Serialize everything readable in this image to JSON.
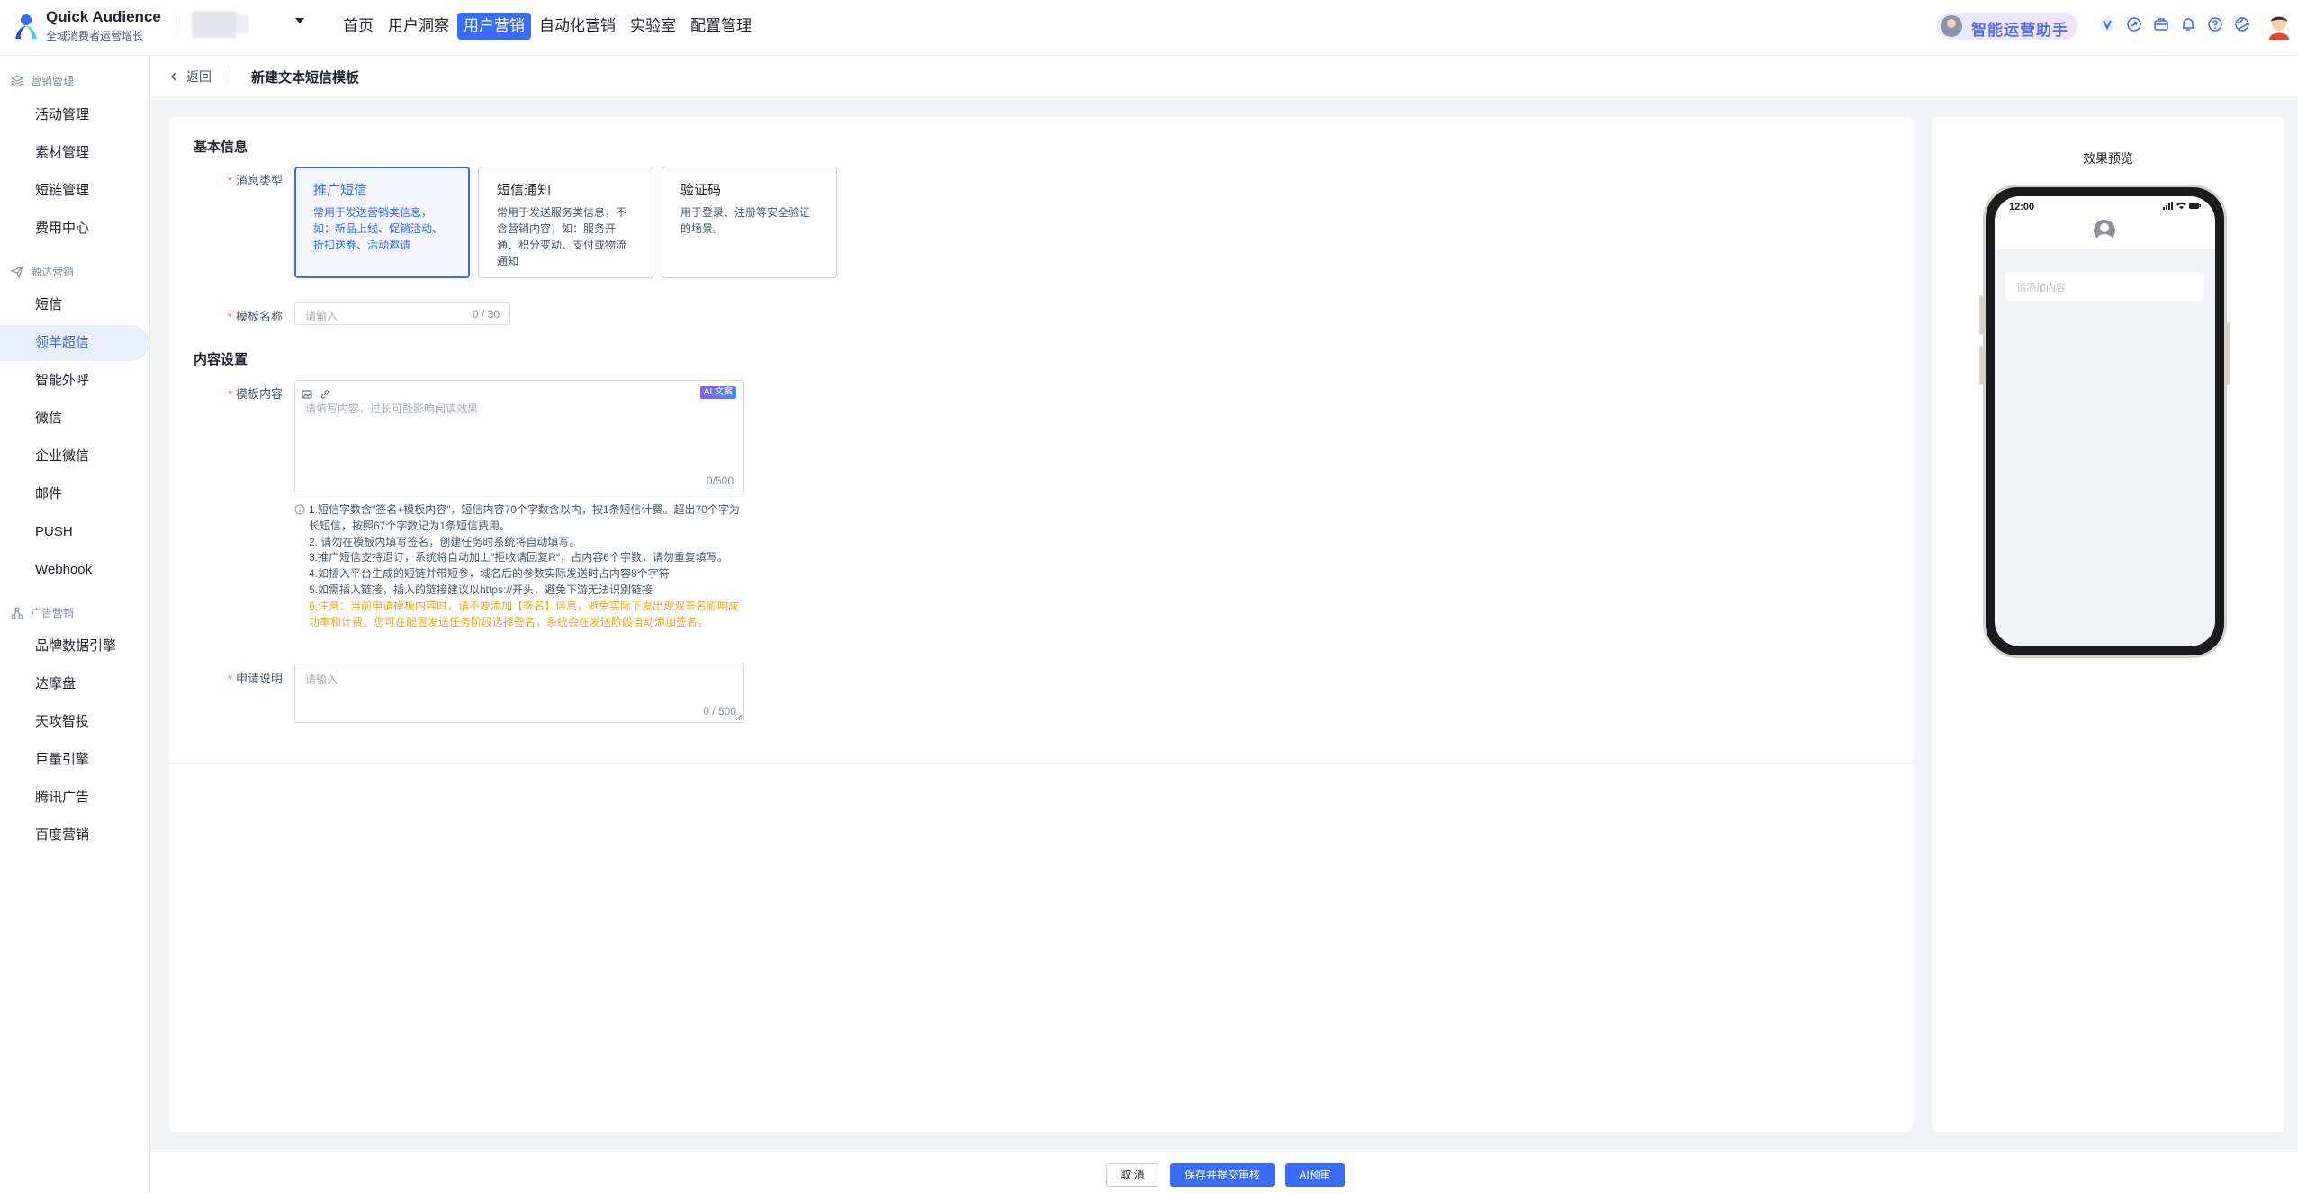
{
  "app": {
    "title": "Quick Audience",
    "subtitle": "全域消费者运营增长"
  },
  "nav": {
    "items": [
      "首页",
      "用户洞察",
      "用户营销",
      "自动化营销",
      "实验室",
      "配置管理"
    ],
    "active_index": 2
  },
  "assistant": {
    "label": "智能运营助手"
  },
  "top_icons": [
    "v-badge-icon",
    "share-icon",
    "briefcase-icon",
    "bell-icon",
    "help-icon",
    "globe-icon"
  ],
  "sidebar": {
    "groups": [
      {
        "label": "营销管理",
        "icon": "layers-icon",
        "items": [
          "活动管理",
          "素材管理",
          "短链管理",
          "费用中心"
        ]
      },
      {
        "label": "触达营销",
        "icon": "send-icon",
        "items": [
          "短信",
          "领羊超信",
          "智能外呼",
          "微信",
          "企业微信",
          "邮件",
          "PUSH",
          "Webhook"
        ]
      },
      {
        "label": "广告营销",
        "icon": "cluster-icon",
        "items": [
          "品牌数据引擎",
          "达摩盘",
          "天攻智投",
          "巨量引擎",
          "腾讯广告",
          "百度营销"
        ]
      }
    ],
    "active_item": "领羊超信"
  },
  "breadcrumb": {
    "back_label": "返回",
    "page_title": "新建文本短信模板"
  },
  "form": {
    "section_basic": "基本信息",
    "msg_type_label": "消息类型",
    "msg_types": [
      {
        "title": "推广短信",
        "desc": "常用于发送营销类信息，如：新品上线、促销活动、折扣送券、活动邀请",
        "selected": true
      },
      {
        "title": "短信通知",
        "desc": "常用于发送服务类信息，不含营销内容，如：服务开通、积分变动、支付或物流通知",
        "selected": false
      },
      {
        "title": "验证码",
        "desc": "用于登录、注册等安全验证的场景。",
        "selected": false
      }
    ],
    "template_name_label": "模板名称",
    "template_name_placeholder": "请输入",
    "template_name_count": "0 / 30",
    "section_content": "内容设置",
    "template_content_label": "模板内容",
    "template_content_placeholder": "请填写内容，过长可能影响阅读效果",
    "template_content_count": "0/500",
    "ai_badge": "AI 文案",
    "notes": [
      "1.短信字数含\"签名+模板内容\"，短信内容70个字数含以内，按1条短信计费。超出70个字为",
      "长短信，按照67个字数记为1条短信费用。",
      "2. 请勿在模板内填写签名，创建任务时系统将自动填写。",
      "3.推广短信支持退订，系统将自动加上\"拒收请回复R\"，占内容6个字数，请勿重复填写。",
      "4.如插入平台生成的短链并带短参，域名后的参数实际发送时占内容8个字符",
      "5.如需插入链接，插入的链接建议以https://开头，避免下游无法识别链接"
    ],
    "warning": [
      "6.注意：当前申请模板内容时，请不要添加【签名】信息，避免实际下发出现双签名影响成",
      "功率和计费。您可在配置发送任务阶段选择签名，系统会在发送阶段自动添加签名。"
    ],
    "apply_label": "申请说明",
    "apply_placeholder": "请输入",
    "apply_count": "0 / 500"
  },
  "preview": {
    "title": "效果预览",
    "time": "12:00",
    "bubble_placeholder": "请添加内容"
  },
  "footer": {
    "cancel": "取 消",
    "save_submit": "保存并提交审核",
    "ai_review": "AI预审"
  },
  "colors": {
    "accent": "#3b6cf6",
    "warning": "#f5a623",
    "required": "#f53f3f"
  }
}
